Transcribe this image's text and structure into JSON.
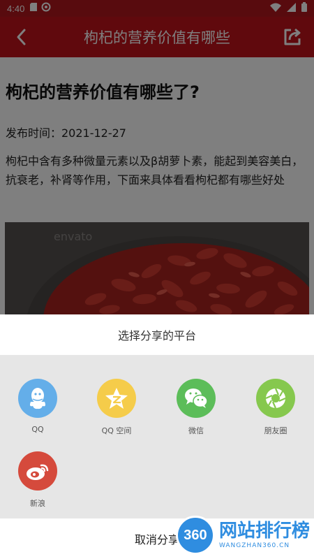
{
  "status_bar": {
    "time": "4:40"
  },
  "header": {
    "title": "枸杞的营养价值有哪些"
  },
  "article": {
    "title": "枸杞的营养价值有哪些了?",
    "date": "发布时间：2021-12-27",
    "body": "枸杞中含有多种微量元素以及β胡萝卜素，能起到美容美白，抗衰老，补肾等作用，下面来具体看看枸杞都有哪些好处",
    "image_watermark": "envato"
  },
  "share_sheet": {
    "title": "选择分享的平台",
    "platforms": [
      {
        "label": "QQ",
        "icon": "qq-icon",
        "color": "#64aee9"
      },
      {
        "label": "QQ 空间",
        "icon": "qzone-icon",
        "color": "#f5cc4a"
      },
      {
        "label": "微信",
        "icon": "wechat-icon",
        "color": "#5cbd59"
      },
      {
        "label": "朋友圈",
        "icon": "moments-icon",
        "color": "#86c84e"
      },
      {
        "label": "新浪",
        "icon": "weibo-icon",
        "color": "#d54a3c"
      }
    ],
    "cancel": "取消分享"
  },
  "watermark": {
    "badge": "360",
    "name": "网站排行榜",
    "url": "WANGZHAN360.CN"
  }
}
